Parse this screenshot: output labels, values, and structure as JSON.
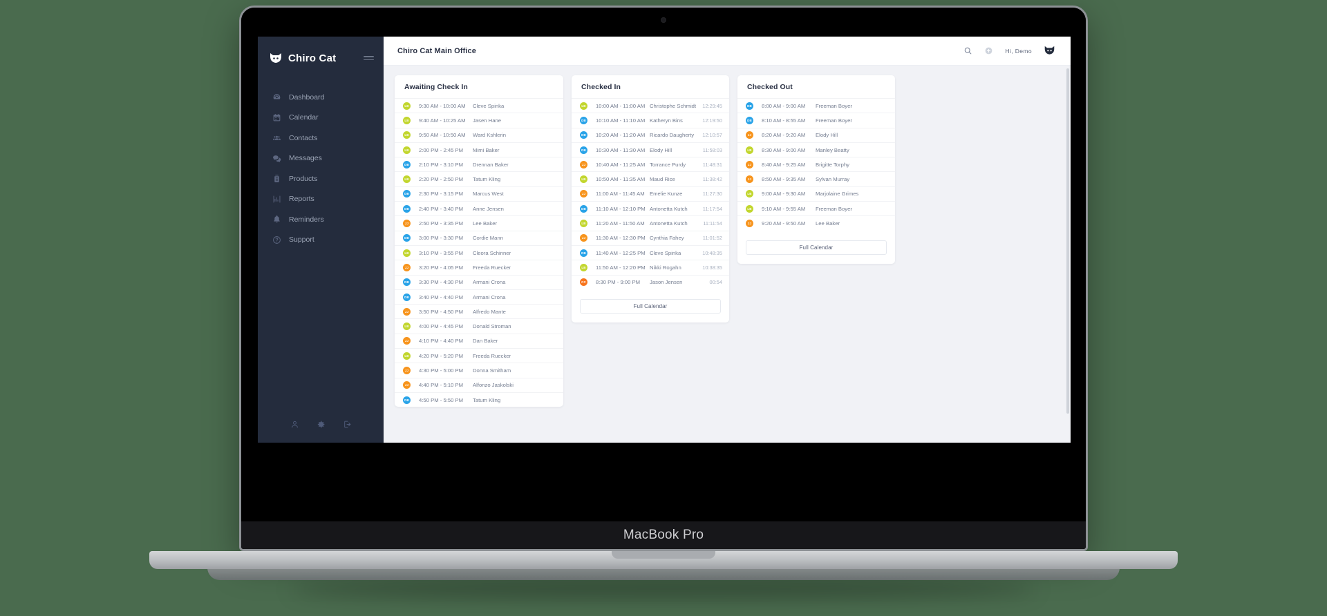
{
  "device": {
    "model_label": "MacBook Pro"
  },
  "app": {
    "brand_name": "Chiro Cat",
    "brand_logo_icon": "cat-face-icon",
    "menu_toggle_icon": "hamburger-icon"
  },
  "sidebar": {
    "items": [
      {
        "label": "Dashboard",
        "icon": "speedometer-icon"
      },
      {
        "label": "Calendar",
        "icon": "calendar-icon"
      },
      {
        "label": "Contacts",
        "icon": "people-icon"
      },
      {
        "label": "Messages",
        "icon": "chat-bubbles-icon"
      },
      {
        "label": "Products",
        "icon": "bottle-icon"
      },
      {
        "label": "Reports",
        "icon": "bar-chart-icon"
      },
      {
        "label": "Reminders",
        "icon": "bell-icon"
      },
      {
        "label": "Support",
        "icon": "question-circle-icon"
      }
    ],
    "bottom_icons": [
      {
        "name": "user-profile-icon"
      },
      {
        "name": "settings-gear-icon"
      },
      {
        "name": "logout-icon"
      }
    ]
  },
  "topbar": {
    "office_title": "Chiro Cat Main Office",
    "search_icon": "search-icon",
    "add_icon": "plus-circle-icon",
    "greeting": "Hi, Demo",
    "avatar_icon": "cat-face-avatar-icon"
  },
  "colors": {
    "sidebar_bg": "#242c3d",
    "page_bg": "#f1f2f6",
    "badge_LB": "#c2d62e",
    "badge_DB": "#29a3e8",
    "badge_JJ": "#f7941d",
    "badge_CC": "#f7741d",
    "backdrop": "#4a6b4e"
  },
  "panels": [
    {
      "title": "Awaiting Check In",
      "has_footer_button": false,
      "rows": [
        {
          "initials": "LB",
          "time": "9:30 AM - 10:00 AM",
          "name": "Cleve Spinka"
        },
        {
          "initials": "LB",
          "time": "9:40 AM - 10:25 AM",
          "name": "Jasen Hane"
        },
        {
          "initials": "LB",
          "time": "9:50 AM - 10:50 AM",
          "name": "Ward Kshlerin"
        },
        {
          "initials": "LB",
          "time": "2:00 PM - 2:45 PM",
          "name": "Mimi Baker"
        },
        {
          "initials": "DB",
          "time": "2:10 PM - 3:10 PM",
          "name": "Drennan Baker"
        },
        {
          "initials": "LB",
          "time": "2:20 PM - 2:50 PM",
          "name": "Tatum Kling"
        },
        {
          "initials": "DB",
          "time": "2:30 PM - 3:15 PM",
          "name": "Marcus West"
        },
        {
          "initials": "DB",
          "time": "2:40 PM - 3:40 PM",
          "name": "Anne Jensen"
        },
        {
          "initials": "JJ",
          "time": "2:50 PM - 3:35 PM",
          "name": "Lee Baker"
        },
        {
          "initials": "DB",
          "time": "3:00 PM - 3:30 PM",
          "name": "Cordie Mann"
        },
        {
          "initials": "LB",
          "time": "3:10 PM - 3:55 PM",
          "name": "Cleora Schinner"
        },
        {
          "initials": "JJ",
          "time": "3:20 PM - 4:05 PM",
          "name": "Freeda Ruecker"
        },
        {
          "initials": "DB",
          "time": "3:30 PM - 4:30 PM",
          "name": "Armani Crona"
        },
        {
          "initials": "DB",
          "time": "3:40 PM - 4:40 PM",
          "name": "Armani Crona"
        },
        {
          "initials": "JJ",
          "time": "3:50 PM - 4:50 PM",
          "name": "Alfredo Mante"
        },
        {
          "initials": "LB",
          "time": "4:00 PM - 4:45 PM",
          "name": "Donald Stroman"
        },
        {
          "initials": "JJ",
          "time": "4:10 PM - 4:40 PM",
          "name": "Dan Baker"
        },
        {
          "initials": "LB",
          "time": "4:20 PM - 5:20 PM",
          "name": "Freeda Ruecker"
        },
        {
          "initials": "JJ",
          "time": "4:30 PM - 5:00 PM",
          "name": "Donna Smitham"
        },
        {
          "initials": "JJ",
          "time": "4:40 PM - 5:10 PM",
          "name": "Alfonzo Jaskolski"
        },
        {
          "initials": "DB",
          "time": "4:50 PM - 5:50 PM",
          "name": "Tatum Kling"
        }
      ]
    },
    {
      "title": "Checked In",
      "has_footer_button": true,
      "footer_button_label": "Full Calendar",
      "rows": [
        {
          "initials": "LB",
          "time": "10:00 AM - 11:00 AM",
          "name": "Christophe Schmidt",
          "duration": "12:29:45"
        },
        {
          "initials": "DB",
          "time": "10:10 AM - 11:10 AM",
          "name": "Katheryn Bins",
          "duration": "12:19:50"
        },
        {
          "initials": "DB",
          "time": "10:20 AM - 11:20 AM",
          "name": "Ricardo Daugherty",
          "duration": "12:10:57"
        },
        {
          "initials": "DB",
          "time": "10:30 AM - 11:30 AM",
          "name": "Elody Hill",
          "duration": "11:58:03"
        },
        {
          "initials": "JJ",
          "time": "10:40 AM - 11:25 AM",
          "name": "Torrance Purdy",
          "duration": "11:48:31"
        },
        {
          "initials": "LB",
          "time": "10:50 AM - 11:35 AM",
          "name": "Maud Rice",
          "duration": "11:38:42"
        },
        {
          "initials": "JJ",
          "time": "11:00 AM - 11:45 AM",
          "name": "Emelie Kunze",
          "duration": "11:27:30"
        },
        {
          "initials": "DB",
          "time": "11:10 AM - 12:10 PM",
          "name": "Antonetta Kutch",
          "duration": "11:17:54"
        },
        {
          "initials": "LB",
          "time": "11:20 AM - 11:50 AM",
          "name": "Antonetta Kutch",
          "duration": "11:11:54"
        },
        {
          "initials": "JJ",
          "time": "11:30 AM - 12:30 PM",
          "name": "Cynthia Fahey",
          "duration": "11:01:52"
        },
        {
          "initials": "DB",
          "time": "11:40 AM - 12:25 PM",
          "name": "Cleve Spinka",
          "duration": "10:48:35"
        },
        {
          "initials": "LB",
          "time": "11:50 AM - 12:20 PM",
          "name": "Nikki Rogahn",
          "duration": "10:38:35"
        },
        {
          "initials": "CC",
          "time": "8:30 PM - 9:00 PM",
          "name": "Jason Jensen",
          "duration": "00:54"
        }
      ]
    },
    {
      "title": "Checked Out",
      "has_footer_button": true,
      "footer_button_label": "Full Calendar",
      "rows": [
        {
          "initials": "DB",
          "time": "8:00 AM - 9:00 AM",
          "name": "Freeman Boyer"
        },
        {
          "initials": "DB",
          "time": "8:10 AM - 8:55 AM",
          "name": "Freeman Boyer"
        },
        {
          "initials": "JJ",
          "time": "8:20 AM - 9:20 AM",
          "name": "Elody Hill"
        },
        {
          "initials": "LB",
          "time": "8:30 AM - 9:00 AM",
          "name": "Manley Beatty"
        },
        {
          "initials": "JJ",
          "time": "8:40 AM - 9:25 AM",
          "name": "Brigitte Torphy"
        },
        {
          "initials": "JJ",
          "time": "8:50 AM - 9:35 AM",
          "name": "Sylvan Murray"
        },
        {
          "initials": "LB",
          "time": "9:00 AM - 9:30 AM",
          "name": "Marjolaine Grimes"
        },
        {
          "initials": "LB",
          "time": "9:10 AM - 9:55 AM",
          "name": "Freeman Boyer"
        },
        {
          "initials": "JJ",
          "time": "9:20 AM - 9:50 AM",
          "name": "Lee Baker"
        }
      ]
    }
  ]
}
